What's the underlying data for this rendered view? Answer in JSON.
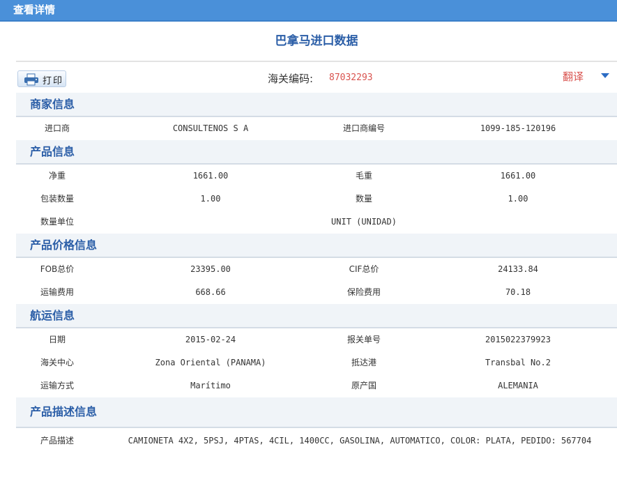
{
  "window": {
    "title": "查看详情"
  },
  "page": {
    "title": "巴拿马进口数据"
  },
  "toolbar": {
    "print_label": "打印",
    "customs_code_label": "海关编码:",
    "customs_code": "87032293",
    "translate_label": "翻译"
  },
  "sections": {
    "merchant": {
      "title": "商家信息",
      "importer_label": "进口商",
      "importer": "CONSULTENOS S A",
      "importer_no_label": "进口商编号",
      "importer_no": "1099-185-120196"
    },
    "product": {
      "title": "产品信息",
      "net_weight_label": "净重",
      "net_weight": "1661.00",
      "gross_weight_label": "毛重",
      "gross_weight": "1661.00",
      "packages_label": "包装数量",
      "packages": "1.00",
      "quantity_label": "数量",
      "quantity": "1.00",
      "unit_label": "数量单位",
      "unit": "UNIT (UNIDAD)"
    },
    "price": {
      "title": "产品价格信息",
      "fob_label": "FOB总价",
      "fob": "23395.00",
      "cif_label": "CIF总价",
      "cif": "24133.84",
      "freight_label": "运输费用",
      "freight": "668.66",
      "insurance_label": "保险费用",
      "insurance": "70.18"
    },
    "shipping": {
      "title": "航运信息",
      "date_label": "日期",
      "date": "2015-02-24",
      "declaration_label": "报关单号",
      "declaration": "2015022379923",
      "customs_center_label": "海关中心",
      "customs_center": "Zona Oriental (PANAMA)",
      "port_label": "抵达港",
      "port": "Transbal No.2",
      "transport_label": "运输方式",
      "transport": "Marítimo",
      "origin_label": "原产国",
      "origin": "ALEMANIA"
    },
    "description": {
      "title": "产品描述信息",
      "desc_label": "产品描述",
      "desc": "CAMIONETA 4X2, 5PSJ, 4PTAS, 4CIL, 1400CC, GASOLINA, AUTOMATICO, COLOR: PLATA, PEDIDO: 567704"
    }
  },
  "colors": {
    "titlebar": "#4a90d9",
    "accent": "#2b5ea7",
    "highlight": "#d9534f"
  }
}
